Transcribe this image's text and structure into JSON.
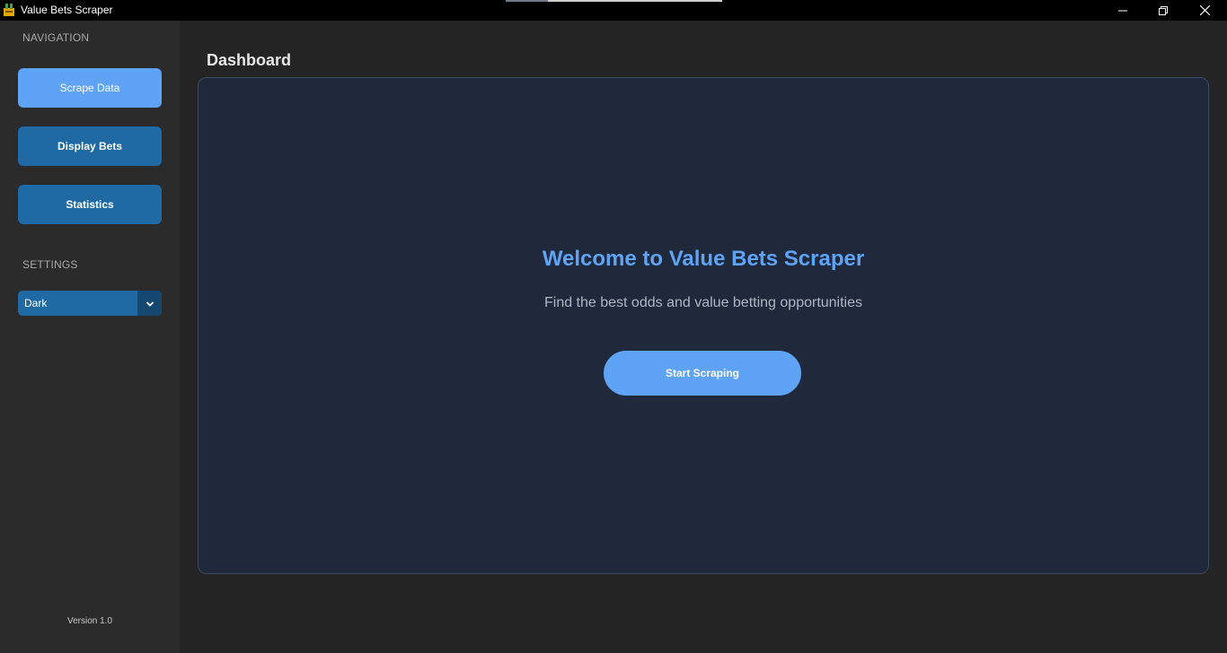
{
  "window": {
    "title": "Value Bets Scraper",
    "icon": "app-icon",
    "controls": [
      "minimize-icon",
      "restore-icon",
      "close-icon"
    ]
  },
  "sidebar": {
    "navigation_label": "NAVIGATION",
    "items": [
      {
        "label": "Scrape Data",
        "active": true
      },
      {
        "label": "Display Bets",
        "active": false
      },
      {
        "label": "Statistics",
        "active": false
      }
    ],
    "settings_label": "SETTINGS",
    "theme_select": {
      "value": "Dark",
      "icon": "chevron-down-icon"
    },
    "version": "Version 1.0"
  },
  "main": {
    "page_title": "Dashboard",
    "welcome_title": "Welcome to Value Bets Scraper",
    "subtitle": "Find the best odds and value betting opportunities",
    "start_button": "Start Scraping"
  },
  "colors": {
    "accent": "#5ea3f5",
    "button": "#1f6aa5",
    "panel": "#1f293b",
    "sidebar": "#2b2b2b",
    "background": "#242424"
  }
}
